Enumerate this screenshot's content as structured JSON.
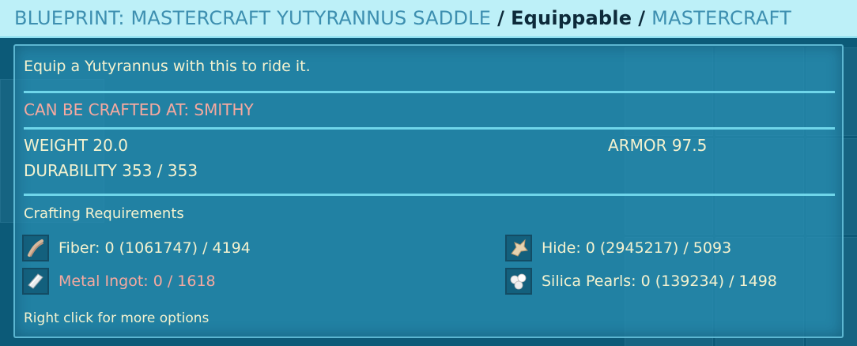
{
  "header": {
    "item_name": "BLUEPRINT: MASTERCRAFT YUTYRANNUS SADDLE",
    "separator": "/",
    "category": "Equippable",
    "quality": "MASTERCRAFT"
  },
  "tooltip": {
    "description": "Equip a Yutyrannus with this to ride it.",
    "crafted_at": "CAN BE CRAFTED AT: SMITHY",
    "weight": "WEIGHT 20.0",
    "armor": "ARMOR 97.5",
    "durability": "DURABILITY 353 / 353",
    "requirements_title": "Crafting Requirements",
    "requirements": [
      {
        "label": "Fiber: 0 (1061747) / 4194",
        "icon": "fiber-icon"
      },
      {
        "label": "Hide: 0 (2945217) / 5093",
        "icon": "hide-icon"
      },
      {
        "label": "Metal Ingot: 0 / 1618",
        "icon": "metal-ingot-icon"
      },
      {
        "label": "Silica Pearls: 0 (139234) / 1498",
        "icon": "silica-pearls-icon"
      }
    ],
    "hint": "Right click for more options"
  },
  "colors": {
    "header_bg": "#bdf0f8",
    "panel_bg": "#288caf",
    "text_light": "#f4f2cf",
    "text_warning": "#f5a9a0",
    "divider": "#6fd6ea"
  }
}
